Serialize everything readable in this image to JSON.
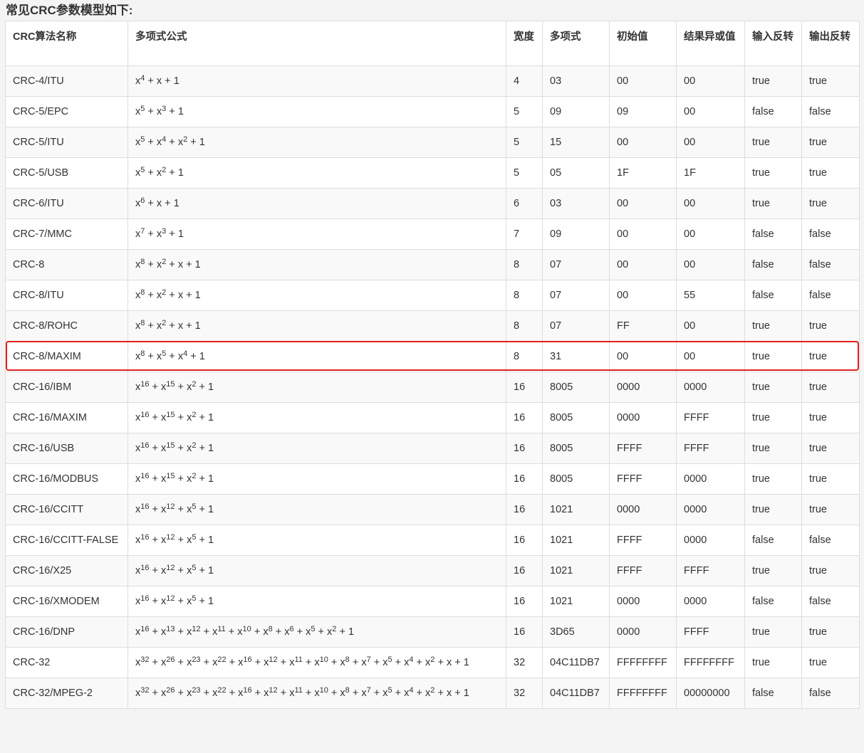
{
  "title": "常见CRC参数模型如下:",
  "headers": [
    "CRC算法名称",
    "多项式公式",
    "宽度",
    "多项式",
    "初始值",
    "结果异或值",
    "输入反转",
    "输出反转"
  ],
  "highlight_color": "#e02020",
  "highlighted_row": "CRC-8/MAXIM",
  "rows": [
    {
      "name": "CRC-4/ITU",
      "poly_terms": [
        [
          "x",
          "4"
        ],
        [
          "x",
          ""
        ],
        [
          "1",
          ""
        ]
      ],
      "width": "4",
      "poly": "03",
      "init": "00",
      "xorout": "00",
      "refin": "true",
      "refout": "true"
    },
    {
      "name": "CRC-5/EPC",
      "poly_terms": [
        [
          "x",
          "5"
        ],
        [
          "x",
          "3"
        ],
        [
          "1",
          ""
        ]
      ],
      "width": "5",
      "poly": "09",
      "init": "09",
      "xorout": "00",
      "refin": "false",
      "refout": "false"
    },
    {
      "name": "CRC-5/ITU",
      "poly_terms": [
        [
          "x",
          "5"
        ],
        [
          "x",
          "4"
        ],
        [
          "x",
          "2"
        ],
        [
          "1",
          ""
        ]
      ],
      "width": "5",
      "poly": "15",
      "init": "00",
      "xorout": "00",
      "refin": "true",
      "refout": "true"
    },
    {
      "name": "CRC-5/USB",
      "poly_terms": [
        [
          "x",
          "5"
        ],
        [
          "x",
          "2"
        ],
        [
          "1",
          ""
        ]
      ],
      "width": "5",
      "poly": "05",
      "init": "1F",
      "xorout": "1F",
      "refin": "true",
      "refout": "true"
    },
    {
      "name": "CRC-6/ITU",
      "poly_terms": [
        [
          "x",
          "6"
        ],
        [
          "x",
          ""
        ],
        [
          "1",
          ""
        ]
      ],
      "width": "6",
      "poly": "03",
      "init": "00",
      "xorout": "00",
      "refin": "true",
      "refout": "true"
    },
    {
      "name": "CRC-7/MMC",
      "poly_terms": [
        [
          "x",
          "7"
        ],
        [
          "x",
          "3"
        ],
        [
          "1",
          ""
        ]
      ],
      "width": "7",
      "poly": "09",
      "init": "00",
      "xorout": "00",
      "refin": "false",
      "refout": "false"
    },
    {
      "name": "CRC-8",
      "poly_terms": [
        [
          "x",
          "8"
        ],
        [
          "x",
          "2"
        ],
        [
          "x",
          ""
        ],
        [
          "1",
          ""
        ]
      ],
      "width": "8",
      "poly": "07",
      "init": "00",
      "xorout": "00",
      "refin": "false",
      "refout": "false"
    },
    {
      "name": "CRC-8/ITU",
      "poly_terms": [
        [
          "x",
          "8"
        ],
        [
          "x",
          "2"
        ],
        [
          "x",
          ""
        ],
        [
          "1",
          ""
        ]
      ],
      "width": "8",
      "poly": "07",
      "init": "00",
      "xorout": "55",
      "refin": "false",
      "refout": "false"
    },
    {
      "name": "CRC-8/ROHC",
      "poly_terms": [
        [
          "x",
          "8"
        ],
        [
          "x",
          "2"
        ],
        [
          "x",
          ""
        ],
        [
          "1",
          ""
        ]
      ],
      "width": "8",
      "poly": "07",
      "init": "FF",
      "xorout": "00",
      "refin": "true",
      "refout": "true"
    },
    {
      "name": "CRC-8/MAXIM",
      "poly_terms": [
        [
          "x",
          "8"
        ],
        [
          "x",
          "5"
        ],
        [
          "x",
          "4"
        ],
        [
          "1",
          ""
        ]
      ],
      "width": "8",
      "poly": "31",
      "init": "00",
      "xorout": "00",
      "refin": "true",
      "refout": "true"
    },
    {
      "name": "CRC-16/IBM",
      "poly_terms": [
        [
          "x",
          "16"
        ],
        [
          "x",
          "15"
        ],
        [
          "x",
          "2"
        ],
        [
          "1",
          ""
        ]
      ],
      "width": "16",
      "poly": "8005",
      "init": "0000",
      "xorout": "0000",
      "refin": "true",
      "refout": "true"
    },
    {
      "name": "CRC-16/MAXIM",
      "poly_terms": [
        [
          "x",
          "16"
        ],
        [
          "x",
          "15"
        ],
        [
          "x",
          "2"
        ],
        [
          "1",
          ""
        ]
      ],
      "width": "16",
      "poly": "8005",
      "init": "0000",
      "xorout": "FFFF",
      "refin": "true",
      "refout": "true"
    },
    {
      "name": "CRC-16/USB",
      "poly_terms": [
        [
          "x",
          "16"
        ],
        [
          "x",
          "15"
        ],
        [
          "x",
          "2"
        ],
        [
          "1",
          ""
        ]
      ],
      "width": "16",
      "poly": "8005",
      "init": "FFFF",
      "xorout": "FFFF",
      "refin": "true",
      "refout": "true"
    },
    {
      "name": "CRC-16/MODBUS",
      "poly_terms": [
        [
          "x",
          "16"
        ],
        [
          "x",
          "15"
        ],
        [
          "x",
          "2"
        ],
        [
          "1",
          ""
        ]
      ],
      "width": "16",
      "poly": "8005",
      "init": "FFFF",
      "xorout": "0000",
      "refin": "true",
      "refout": "true"
    },
    {
      "name": "CRC-16/CCITT",
      "poly_terms": [
        [
          "x",
          "16"
        ],
        [
          "x",
          "12"
        ],
        [
          "x",
          "5"
        ],
        [
          "1",
          ""
        ]
      ],
      "width": "16",
      "poly": "1021",
      "init": "0000",
      "xorout": "0000",
      "refin": "true",
      "refout": "true"
    },
    {
      "name": "CRC-16/CCITT-FALSE",
      "poly_terms": [
        [
          "x",
          "16"
        ],
        [
          "x",
          "12"
        ],
        [
          "x",
          "5"
        ],
        [
          "1",
          ""
        ]
      ],
      "width": "16",
      "poly": "1021",
      "init": "FFFF",
      "xorout": "0000",
      "refin": "false",
      "refout": "false"
    },
    {
      "name": "CRC-16/X25",
      "poly_terms": [
        [
          "x",
          "16"
        ],
        [
          "x",
          "12"
        ],
        [
          "x",
          "5"
        ],
        [
          "1",
          ""
        ]
      ],
      "width": "16",
      "poly": "1021",
      "init": "FFFF",
      "xorout": "FFFF",
      "refin": "true",
      "refout": "true"
    },
    {
      "name": "CRC-16/XMODEM",
      "poly_terms": [
        [
          "x",
          "16"
        ],
        [
          "x",
          "12"
        ],
        [
          "x",
          "5"
        ],
        [
          "1",
          ""
        ]
      ],
      "width": "16",
      "poly": "1021",
      "init": "0000",
      "xorout": "0000",
      "refin": "false",
      "refout": "false"
    },
    {
      "name": "CRC-16/DNP",
      "poly_terms": [
        [
          "x",
          "16"
        ],
        [
          "x",
          "13"
        ],
        [
          "x",
          "12"
        ],
        [
          "x",
          "11"
        ],
        [
          "x",
          "10"
        ],
        [
          "x",
          "8"
        ],
        [
          "x",
          "6"
        ],
        [
          "x",
          "5"
        ],
        [
          "x",
          "2"
        ],
        [
          "1",
          ""
        ]
      ],
      "width": "16",
      "poly": "3D65",
      "init": "0000",
      "xorout": "FFFF",
      "refin": "true",
      "refout": "true"
    },
    {
      "name": "CRC-32",
      "poly_terms": [
        [
          "x",
          "32"
        ],
        [
          "x",
          "26"
        ],
        [
          "x",
          "23"
        ],
        [
          "x",
          "22"
        ],
        [
          "x",
          "16"
        ],
        [
          "x",
          "12"
        ],
        [
          "x",
          "11"
        ],
        [
          "x",
          "10"
        ],
        [
          "x",
          "8"
        ],
        [
          "x",
          "7"
        ],
        [
          "x",
          "5"
        ],
        [
          "x",
          "4"
        ],
        [
          "x",
          "2"
        ],
        [
          "x",
          ""
        ],
        [
          "1",
          ""
        ]
      ],
      "width": "32",
      "poly": "04C11DB7",
      "init": "FFFFFFFF",
      "xorout": "FFFFFFFF",
      "refin": "true",
      "refout": "true"
    },
    {
      "name": "CRC-32/MPEG-2",
      "poly_terms": [
        [
          "x",
          "32"
        ],
        [
          "x",
          "26"
        ],
        [
          "x",
          "23"
        ],
        [
          "x",
          "22"
        ],
        [
          "x",
          "16"
        ],
        [
          "x",
          "12"
        ],
        [
          "x",
          "11"
        ],
        [
          "x",
          "10"
        ],
        [
          "x",
          "8"
        ],
        [
          "x",
          "7"
        ],
        [
          "x",
          "5"
        ],
        [
          "x",
          "4"
        ],
        [
          "x",
          "2"
        ],
        [
          "x",
          ""
        ],
        [
          "1",
          ""
        ]
      ],
      "width": "32",
      "poly": "04C11DB7",
      "init": "FFFFFFFF",
      "xorout": "00000000",
      "refin": "false",
      "refout": "false"
    }
  ]
}
